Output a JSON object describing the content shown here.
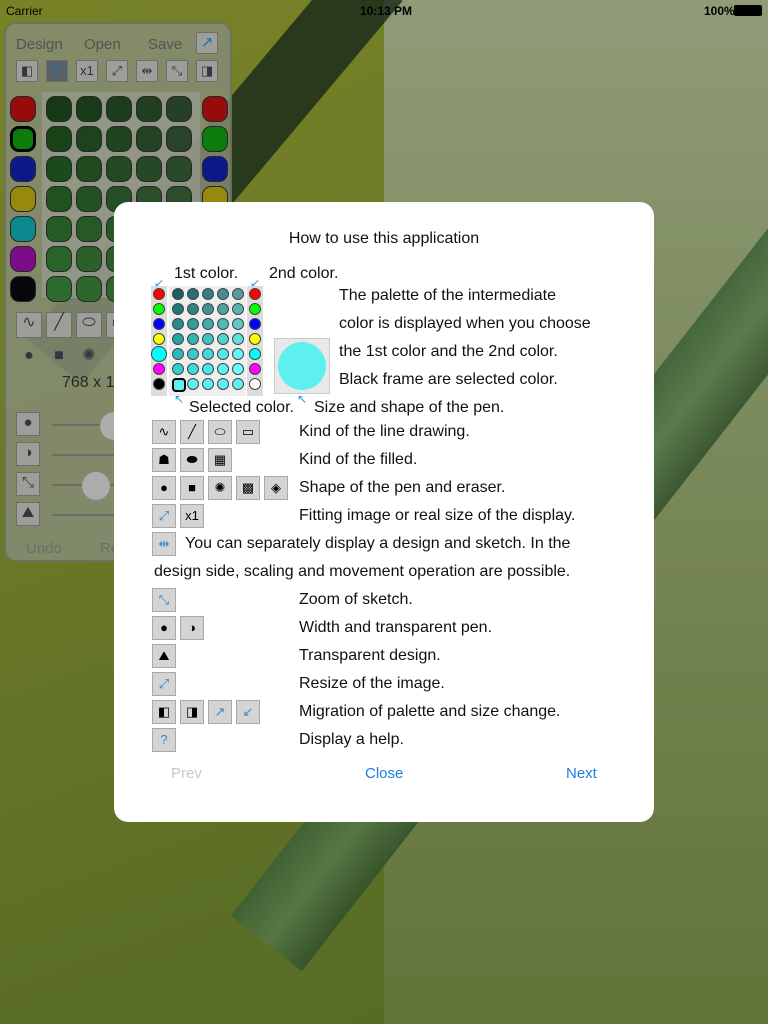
{
  "status": {
    "carrier": "Carrier",
    "time": "10:13 PM",
    "battery": "100%"
  },
  "panel": {
    "menu": [
      "Design",
      "Open",
      "Save"
    ],
    "toolbar_icons": [
      "left-panel-icon",
      "help-icon",
      "real-size-icon",
      "fit-icon",
      "split-icon",
      "zoom-icon",
      "right-panel-icon"
    ],
    "real_size_label": "x1",
    "size_text": "768 x 1",
    "undo": "Undo",
    "redo": "Re",
    "colors_first": [
      "#c01010",
      "#10a010",
      "#1020b0",
      "#c0b010",
      "#10b0b8",
      "#a010b0",
      "#0a0a10"
    ],
    "colors_second": [
      "#c01010",
      "#10a010",
      "#1020b0",
      "#c0b010"
    ]
  },
  "dialog": {
    "title": "How to use this application",
    "first_color": "1st color.",
    "second_color": "2nd color.",
    "palette_desc": [
      "The palette of the intermediate",
      "color is displayed when you choose",
      "the 1st color and the 2nd color.",
      "Black frame are selected color."
    ],
    "selected_color": "Selected color.",
    "size_shape": "Size and shape of the pen.",
    "palette_first": [
      "#ff0000",
      "#00ff00",
      "#0000ff",
      "#ffff00",
      "#00ffff",
      "#ff00ff",
      "#000000"
    ],
    "palette_second": [
      "#ff0000",
      "#00ff00",
      "#0000ff",
      "#ffff00",
      "#00ffff",
      "#ff00ff",
      "#ffffff"
    ],
    "pen_preview_color": "#5ef0f0",
    "rows": [
      {
        "text": "Kind of the line drawing."
      },
      {
        "text": "Kind of the filled."
      },
      {
        "text": "Shape of the pen and eraser."
      },
      {
        "text": "Fitting image or real size of the display."
      },
      {
        "text": "You can separately display a design and sketch. In the"
      },
      {
        "text": "design side, scaling and movement operation are possible."
      },
      {
        "text": "Zoom of sketch."
      },
      {
        "text": "Width and transparent pen."
      },
      {
        "text": "Transparent design."
      },
      {
        "text": "Resize of the image."
      },
      {
        "text": "Migration of palette and size change."
      },
      {
        "text": "Display a help."
      }
    ],
    "real_size_label": "x1",
    "prev": "Prev",
    "close": "Close",
    "next": "Next"
  },
  "accent": "#1a7fe0"
}
